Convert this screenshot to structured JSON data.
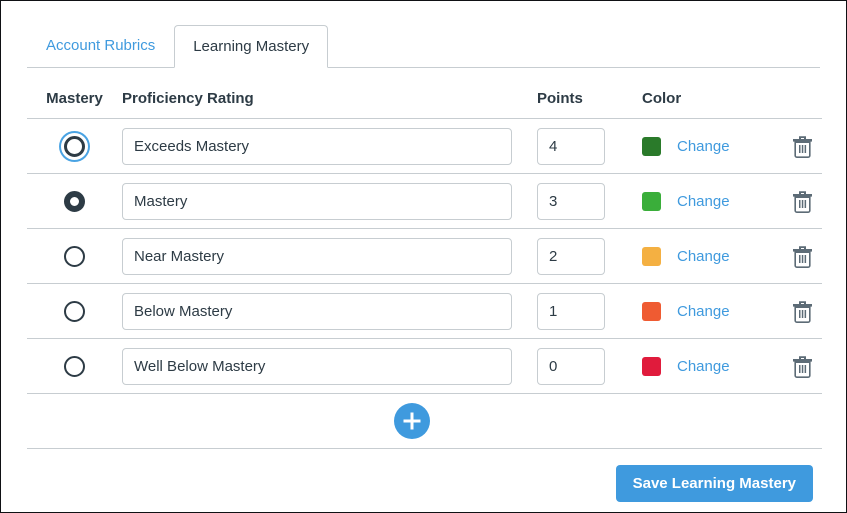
{
  "tabs": [
    {
      "label": "Account Rubrics",
      "active": false,
      "name": "tab-account-rubrics"
    },
    {
      "label": "Learning Mastery",
      "active": true,
      "name": "tab-learning-mastery"
    }
  ],
  "table": {
    "headers": {
      "mastery": "Mastery",
      "rating": "Proficiency Rating",
      "points": "Points",
      "color": "Color"
    },
    "rows": [
      {
        "rating": "Exceeds Mastery",
        "points": "4",
        "color": "#2a7a2a",
        "change_label": "Change",
        "radio_state": "focused"
      },
      {
        "rating": "Mastery",
        "points": "3",
        "color": "#3aae3a",
        "change_label": "Change",
        "radio_state": "selected"
      },
      {
        "rating": "Near Mastery",
        "points": "2",
        "color": "#f4b042",
        "change_label": "Change",
        "radio_state": "unselected"
      },
      {
        "rating": "Below Mastery",
        "points": "1",
        "color": "#ef5b32",
        "change_label": "Change",
        "radio_state": "unselected"
      },
      {
        "rating": "Well Below Mastery",
        "points": "0",
        "color": "#e01b3c",
        "change_label": "Change",
        "radio_state": "unselected"
      }
    ]
  },
  "add_row": {
    "icon": "plus-icon",
    "title": "Add proficiency rating"
  },
  "footer": {
    "save_label": "Save Learning Mastery"
  },
  "colors": {
    "accent_blue": "#3f9ade",
    "text_dark": "#2d3b45",
    "border": "#c7cdd1"
  }
}
